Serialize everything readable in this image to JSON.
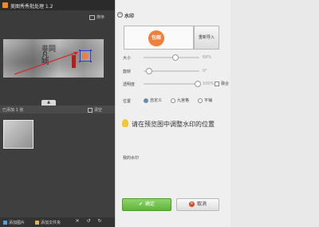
{
  "app": {
    "title": "美图秀秀批处理 1.2"
  },
  "left": {
    "sort_label": "排序",
    "added_label": "已添加 1 张",
    "clear_label": "清空",
    "tab_nub": "▲",
    "preview_calligraphy": "非同\n凡\n响",
    "bottom": {
      "add_image": "添加图片",
      "add_folder": "添加文件夹"
    }
  },
  "panel": {
    "header": "水印",
    "watermark_badge": "包邮",
    "reimport": "重新导入",
    "size_label": "大小",
    "size_value": "69%",
    "size_fraction": 0.56,
    "rotate_label": "旋转",
    "rotate_value": "0°",
    "rotate_fraction": 0.05,
    "opacity_label": "透明度",
    "opacity_value": "100%",
    "opacity_fraction": 1.0,
    "blend_label": "融合",
    "position_label": "位置",
    "position_options": [
      "自定义",
      "九宫格",
      "平铺"
    ],
    "hint": "请在预览图中调整水印的位置",
    "my_watermark": "我的水印",
    "ok": "确定",
    "cancel": "取消"
  },
  "colors": {
    "accent_orange": "#f07e3c",
    "ok_green": "#5fb43a",
    "cancel_red": "#d9472b"
  }
}
